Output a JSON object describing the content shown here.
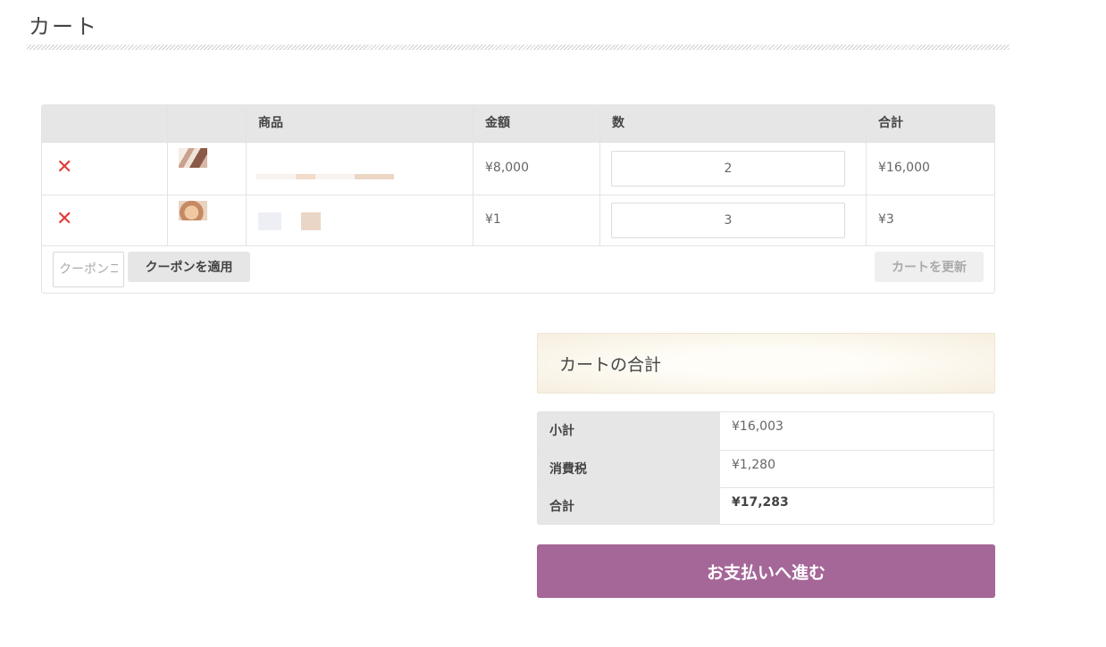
{
  "page": {
    "title": "カート"
  },
  "cart": {
    "headers": [
      "",
      "",
      "商品",
      "金額",
      "数",
      "合計"
    ],
    "rows": [
      {
        "price": "¥8,000",
        "quantity": "2",
        "subtotal": "¥16,000"
      },
      {
        "price": "¥1",
        "quantity": "3",
        "subtotal": "¥3"
      }
    ],
    "remove_symbol": "✕",
    "coupon_placeholder": "クーポンコード",
    "apply_coupon_label": "クーポンを適用",
    "update_cart_label": "カートを更新"
  },
  "totals": {
    "title": "カートの合計",
    "rows": [
      {
        "label": "小計",
        "value": "¥16,003"
      },
      {
        "label": "消費税",
        "value": "¥1,280"
      },
      {
        "label": "合計",
        "value": "¥17,283"
      }
    ]
  },
  "checkout": {
    "label": "お支払いへ進む"
  },
  "colors": {
    "accent": "#a56698",
    "remove": "#e23c3c"
  }
}
